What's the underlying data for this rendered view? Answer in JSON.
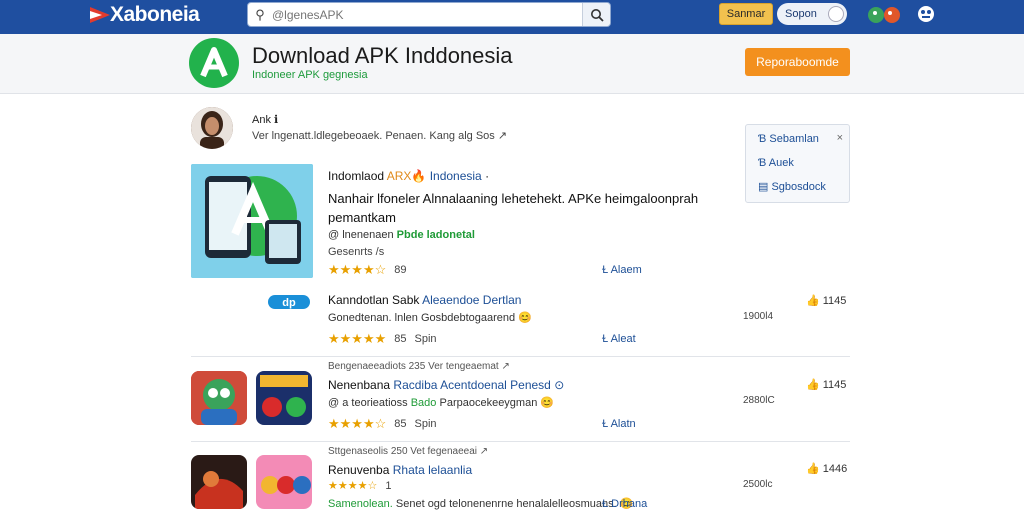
{
  "topbar": {
    "logo_text": "Xaboneia",
    "search_placeholder": "@lgenesAPK",
    "signin_label": "Sanmar",
    "signup_label": "Sopon"
  },
  "header": {
    "title": "Download APK Inddonesia",
    "subtitle": "Indoneer APK gegnesia",
    "report_label": "Reporaboomde"
  },
  "author": {
    "name": "Ank ℹ",
    "meta": "Ver lngenatt.ldlegebeoaek.   Penaen. Kang alg  Sos ↗"
  },
  "sidepanel": {
    "items": [
      "Ɓ Sebamlan",
      "Ɓ Auek",
      "▤ Sgbosdock"
    ],
    "close": "×"
  },
  "featured": {
    "title_a": "Indomlaod",
    "title_b": "ARX🔥",
    "title_c": "Indonesia",
    "title_d": "·",
    "desc": "Nanhair lfoneler Alnnalaaning lehetehekt. APKe heimgaloonprah pemantkam",
    "tag_a": "@ lnenenaen",
    "tag_b": "Pbde ladonetal",
    "category": "Gesenrts /s",
    "stars": "★★★★☆",
    "rating": "89",
    "about": "Ɫ Alaem"
  },
  "rows": [
    {
      "title_a": "Kanndotlan Sabk",
      "title_b": "Aleaendoe Dertlan",
      "sub": "Gonedtenan.   lnlen  Gosbdebtogaarend 😊",
      "stars": "★★★★★",
      "meta_a": "85",
      "meta_b": "Spin",
      "about": "Ɫ Aleat",
      "size": "1900l4",
      "likes": "👍 1145"
    },
    {
      "category": "Bengenaeeadiots  235  Ver  tengeaemat  ↗",
      "title_a": "Nenenbana",
      "title_b": "Racdiba  Acentdoenal  Penesd",
      "title_c": "⊙",
      "sub_a": "@ a teorieatioss",
      "sub_b": "Bado",
      "sub_c": "Parpaocekeeygman 😊",
      "stars": "★★★★☆",
      "meta_a": "85",
      "meta_b": "Spin",
      "about": "Ɫ Alatn",
      "size": "2880lC",
      "likes": "👍 1145"
    },
    {
      "category": "Sttgenaseolis  250  Vet  fegenaeeai  ↗",
      "title_a": "Renuvenba",
      "title_b": "Rhata lelaanlia",
      "stars": "★★★★☆",
      "meta_a": "1",
      "sub_a": "Samenolean.",
      "sub_b": "Senet ogd telonenenrne  henalalelleosmuans. 😊",
      "about": "Ɫ Drhana",
      "size": "2500lc",
      "likes": "👍 1446"
    }
  ]
}
